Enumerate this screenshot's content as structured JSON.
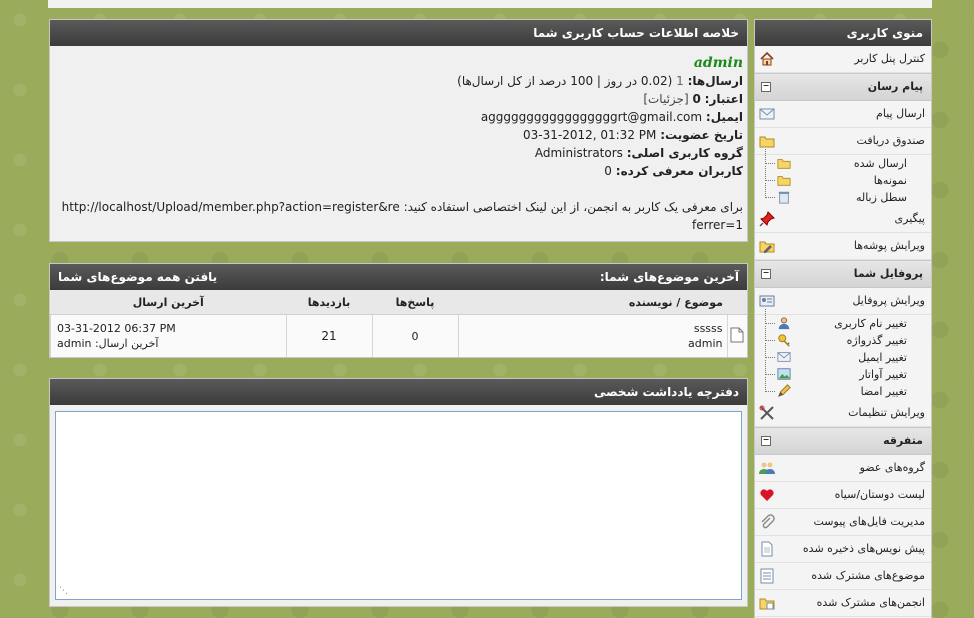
{
  "colors": {
    "header_bg": "#3b3b3b",
    "username": "#1a8a1a",
    "textarea_border": "#7aa6c8"
  },
  "sidebar": {
    "title": "منوی کاربری",
    "items": [
      {
        "type": "item",
        "label": "کنترل پنل کاربر",
        "icon": "home-icon"
      },
      {
        "type": "cat",
        "label": "پیام رسان"
      },
      {
        "type": "item",
        "label": "ارسال پیام",
        "icon": "envelope-icon"
      },
      {
        "type": "item",
        "label": "صندوق دریافت",
        "icon": "folder-icon"
      },
      {
        "type": "sub",
        "label": "ارسال شده",
        "icon": "folder-icon"
      },
      {
        "type": "sub",
        "label": "نمونه‌ها",
        "icon": "folder-icon"
      },
      {
        "type": "sub",
        "label": "سطل زباله",
        "icon": "trash-icon"
      },
      {
        "type": "item",
        "label": "پیگیری",
        "icon": "pushpin-icon"
      },
      {
        "type": "item",
        "label": "ویرایش پوشه‌ها",
        "icon": "folder-edit-icon"
      },
      {
        "type": "cat",
        "label": "پروفایل شما"
      },
      {
        "type": "item",
        "label": "ویرایش پروفایل",
        "icon": "profile-card-icon"
      },
      {
        "type": "sub",
        "label": "تغییر نام کاربری",
        "icon": "user-icon"
      },
      {
        "type": "sub",
        "label": "تغییر گذرواژه",
        "icon": "key-icon"
      },
      {
        "type": "sub",
        "label": "تغییر ایمیل",
        "icon": "envelope-icon"
      },
      {
        "type": "sub",
        "label": "تغییر آواتار",
        "icon": "picture-icon"
      },
      {
        "type": "sub",
        "label": "تغییر امضا",
        "icon": "pencil-icon"
      },
      {
        "type": "item",
        "label": "ویرایش تنظیمات",
        "icon": "tools-icon"
      },
      {
        "type": "cat",
        "label": "متفرقه"
      },
      {
        "type": "item",
        "label": "گروه‌های عضو",
        "icon": "users-icon"
      },
      {
        "type": "item",
        "label": "لیست دوستان/سیاه",
        "icon": "heart-icon"
      },
      {
        "type": "item",
        "label": "مدیریت فایل‌های پیوست",
        "icon": "paperclip-icon"
      },
      {
        "type": "item",
        "label": "پیش نویس‌های ذخیره شده",
        "icon": "document-icon"
      },
      {
        "type": "item",
        "label": "موضوع‌های مشترک شده",
        "icon": "subscribed-thread-icon"
      },
      {
        "type": "item",
        "label": "انجمن‌های مشترک شده",
        "icon": "subscribed-forum-icon"
      }
    ]
  },
  "summary": {
    "title": "خلاصه اطلاعات حساب کاربری شما",
    "username": "admin",
    "posts_label": "ارسال‌ها:",
    "posts_count": "1",
    "posts_detail": "(0.02 در روز | 100 درصد از کل ارسال‌ها)",
    "rep_label": "اعتبار:",
    "rep_value": "0",
    "rep_detail": "[جزئیات]",
    "email_label": "ایمیل:",
    "email_value": "agggggggggggggggggrt@gmail.com",
    "reg_label": "تاریخ عضویت:",
    "reg_value": "03-31-2012, 01:32 PM",
    "group_label": "گروه کاربری اصلی:",
    "group_value": "Administrators",
    "referred_label": "کاربران معرفی کرده:",
    "referred_value": "0",
    "referral_text": "برای معرفی یک کاربر به انجمن، از این لینک اختصاصی استفاده کنید:",
    "referral_link": "http://localhost/Upload/member.php?action=register&referrer=1"
  },
  "topics": {
    "title": "آخرین موضوع‌های شما:",
    "find_all": "یافتن همه موضوع‌های شما",
    "columns": [
      "موضوع / نویسنده",
      "پاسخ‌ها",
      "بازدیدها",
      "آخرین ارسال"
    ],
    "rows": [
      {
        "subject": "sssss",
        "author": "admin",
        "replies": "0",
        "views": "21",
        "last_date": "03-31-2012 06:37 PM",
        "last_by_label": "آخرین ارسال:",
        "last_by": "admin"
      }
    ]
  },
  "notes": {
    "title": "دفترچه یادداشت شخصی",
    "value": ""
  }
}
